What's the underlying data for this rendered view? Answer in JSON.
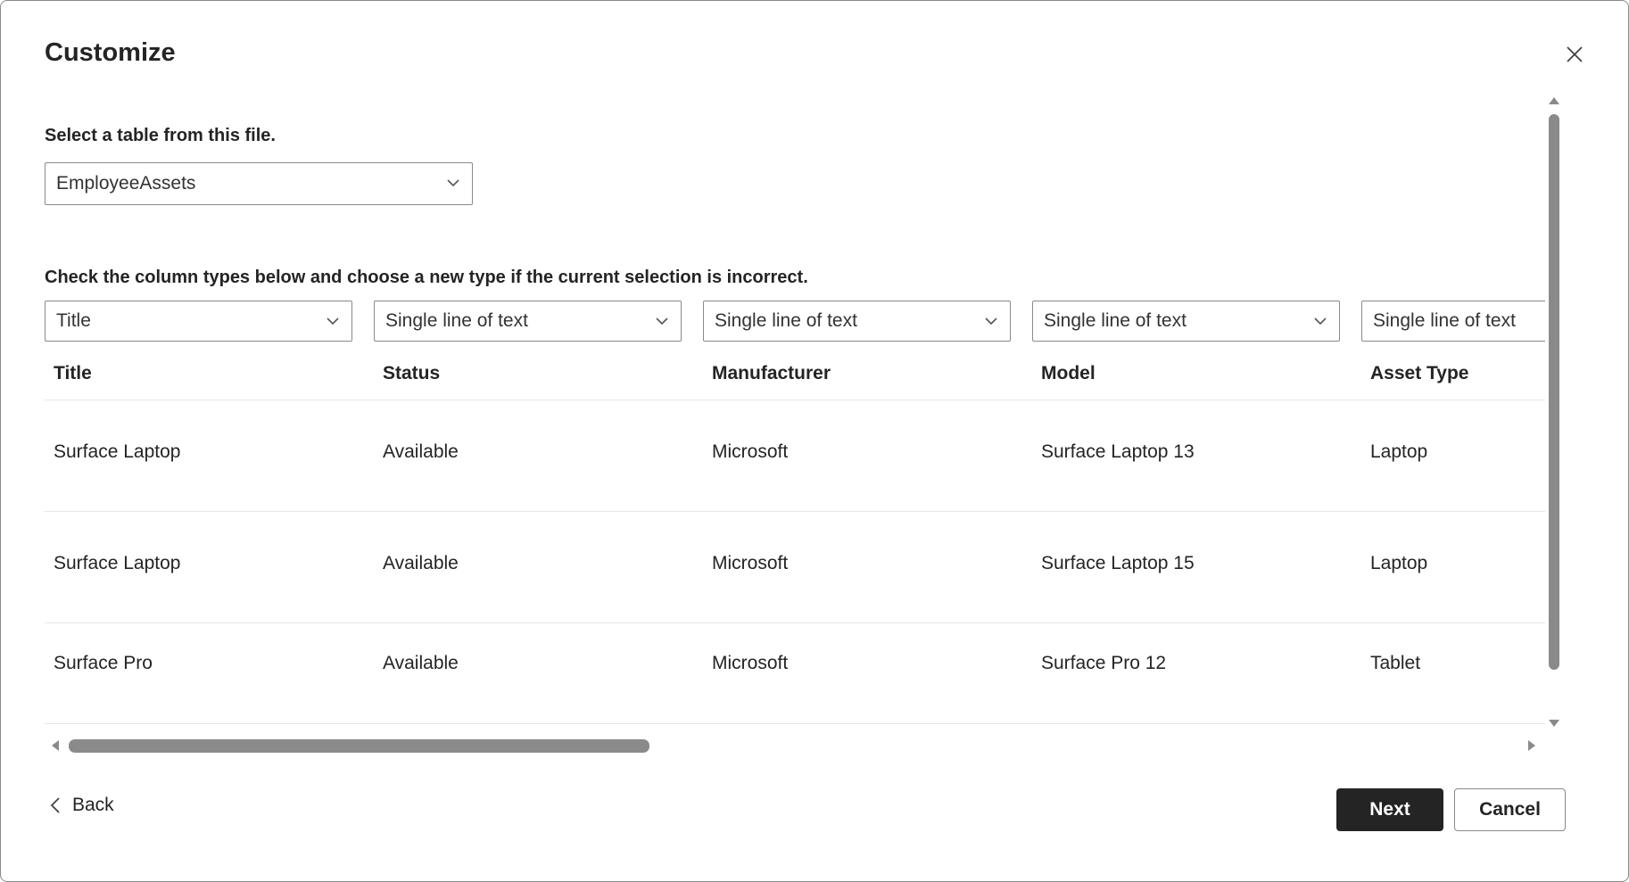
{
  "dialog": {
    "title": "Customize",
    "table_select_label": "Select a table from this file.",
    "table_select_value": "EmployeeAssets",
    "column_types_label": "Check the column types below and choose a new type if the current selection is incorrect."
  },
  "column_types": [
    "Title",
    "Single line of text",
    "Single line of text",
    "Single line of text",
    "Single line of text"
  ],
  "columns": [
    "Title",
    "Status",
    "Manufacturer",
    "Model",
    "Asset Type"
  ],
  "rows": [
    [
      "Surface Laptop",
      "Available",
      "Microsoft",
      "Surface Laptop 13",
      "Laptop"
    ],
    [
      "Surface Laptop",
      "Available",
      "Microsoft",
      "Surface Laptop 15",
      "Laptop"
    ],
    [
      "Surface Pro",
      "Available",
      "Microsoft",
      "Surface Pro 12",
      "Tablet"
    ]
  ],
  "icons": {
    "close": "close-icon",
    "chevron": "chevron-down-icon",
    "back": "chevron-left-icon"
  },
  "footer": {
    "back_label": "Back",
    "next_label": "Next",
    "cancel_label": "Cancel"
  }
}
